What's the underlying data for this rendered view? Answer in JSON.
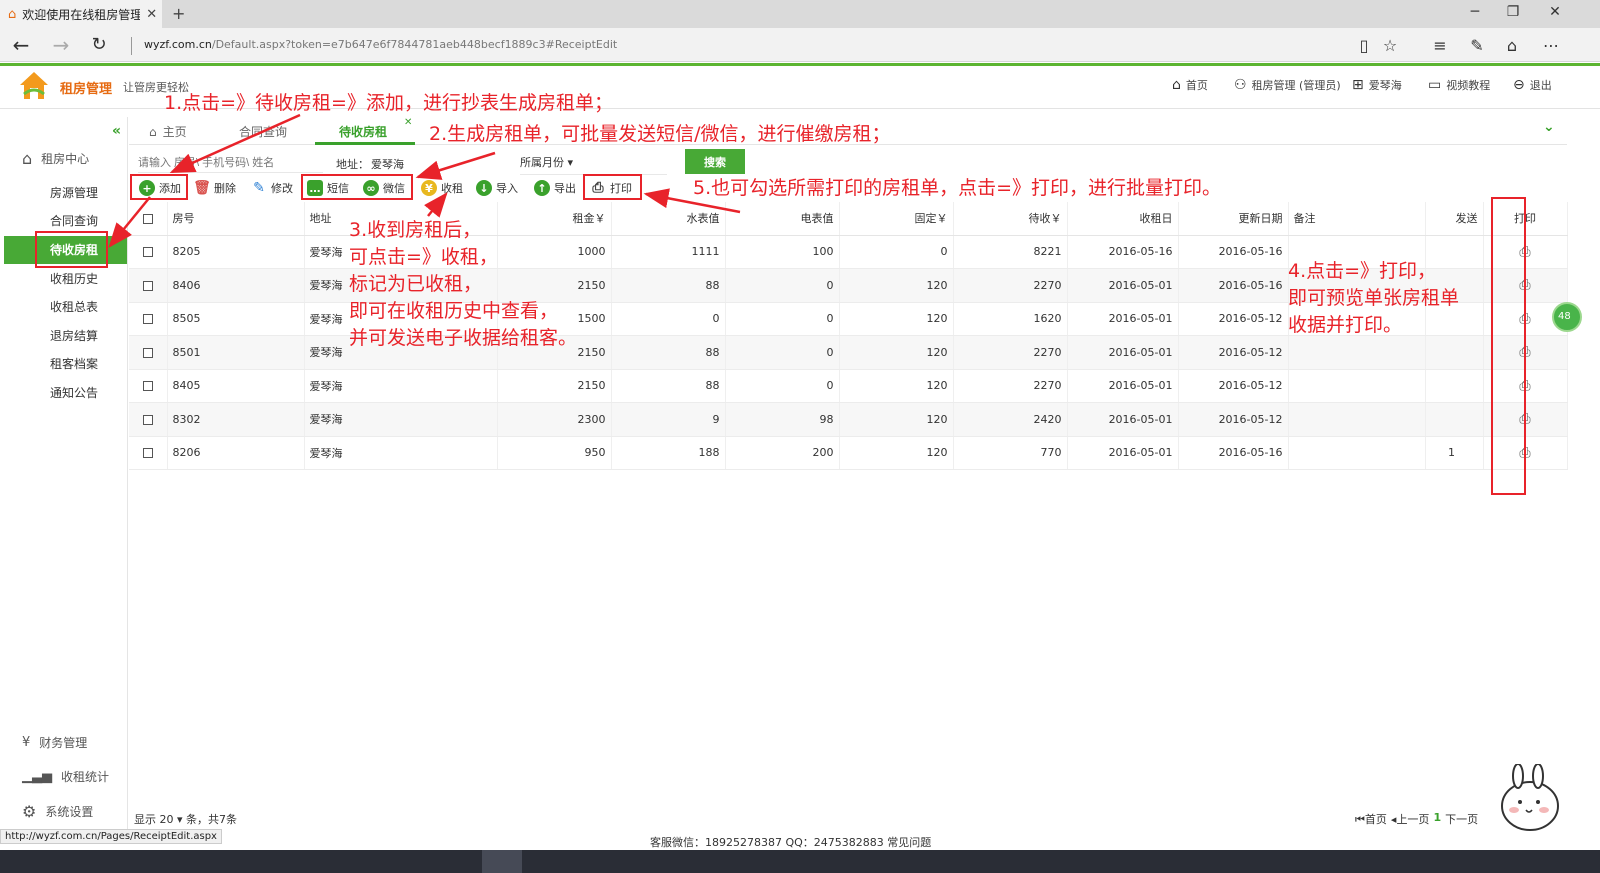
{
  "browser": {
    "tab_title": "欢迎使用在线租房管理",
    "url_domain": "wyzf.com.cn",
    "url_path": "/Default.aspx?token=e7b647e6f7844781aeb448becf1889c3#ReceiptEdit",
    "status_url": "http://wyzf.com.cn/Pages/ReceiptEdit.aspx"
  },
  "header": {
    "app_name": "租房管理",
    "slogan": "让管房更轻松",
    "nav": [
      {
        "label": "首页",
        "icon": "home-icon"
      },
      {
        "label": "租房管理 (管理员)",
        "icon": "user-icon"
      },
      {
        "label": "爱琴海",
        "icon": "sitemap-icon"
      },
      {
        "label": "视频教程",
        "icon": "video-icon"
      },
      {
        "label": "退出",
        "icon": "logout-icon"
      }
    ]
  },
  "sidebar": {
    "main_group": "租房中心",
    "items": [
      "房源管理",
      "合同查询",
      "待收房租",
      "收租历史",
      "收租总表",
      "退房结算",
      "租客档案",
      "通知公告"
    ],
    "active_index": 2,
    "bottom_groups": [
      "财务管理",
      "收租统计",
      "系统设置"
    ]
  },
  "tabs": [
    "主页",
    "合同查询",
    "待收房租"
  ],
  "active_tab": "待收房租",
  "search": {
    "placeholder": "请输入 房号\\ 手机号码\\ 姓名",
    "address_label": "地址：",
    "address_value": "爱琴海",
    "month_label": "所属月份",
    "button": "搜索"
  },
  "toolbar": {
    "add": "添加",
    "delete": "删除",
    "edit": "修改",
    "sms": "短信",
    "wechat": "微信",
    "collect": "收租",
    "import": "导入",
    "export": "导出",
    "print": "打印"
  },
  "table": {
    "headers": [
      "房号",
      "地址",
      "租金￥",
      "水表值",
      "电表值",
      "固定￥",
      "待收￥",
      "收租日",
      "更新日期",
      "备注",
      "发送",
      "打印"
    ],
    "rows": [
      {
        "room": "8205",
        "address": "爱琴海",
        "rent": "1000",
        "water": "1111",
        "electric": "100",
        "fixed": "0",
        "due": "8221",
        "collect_date": "2016-05-16",
        "update_date": "2016-05-16",
        "remark": "",
        "sent": ""
      },
      {
        "room": "8406",
        "address": "爱琴海",
        "rent": "2150",
        "water": "88",
        "electric": "0",
        "fixed": "120",
        "due": "2270",
        "collect_date": "2016-05-01",
        "update_date": "2016-05-16",
        "remark": "",
        "sent": ""
      },
      {
        "room": "8505",
        "address": "爱琴海",
        "rent": "1500",
        "water": "0",
        "electric": "0",
        "fixed": "120",
        "due": "1620",
        "collect_date": "2016-05-01",
        "update_date": "2016-05-12",
        "remark": "",
        "sent": ""
      },
      {
        "room": "8501",
        "address": "爱琴海",
        "rent": "2150",
        "water": "88",
        "electric": "0",
        "fixed": "120",
        "due": "2270",
        "collect_date": "2016-05-01",
        "update_date": "2016-05-12",
        "remark": "",
        "sent": ""
      },
      {
        "room": "8405",
        "address": "爱琴海",
        "rent": "2150",
        "water": "88",
        "electric": "0",
        "fixed": "120",
        "due": "2270",
        "collect_date": "2016-05-01",
        "update_date": "2016-05-12",
        "remark": "",
        "sent": ""
      },
      {
        "room": "8302",
        "address": "爱琴海",
        "rent": "2300",
        "water": "9",
        "electric": "98",
        "fixed": "120",
        "due": "2420",
        "collect_date": "2016-05-01",
        "update_date": "2016-05-12",
        "remark": "",
        "sent": ""
      },
      {
        "room": "8206",
        "address": "爱琴海",
        "rent": "950",
        "water": "188",
        "electric": "200",
        "fixed": "120",
        "due": "770",
        "collect_date": "2016-05-01",
        "update_date": "2016-05-16",
        "remark": "",
        "sent": "1"
      }
    ]
  },
  "pager": {
    "display_prefix": "显示",
    "page_size": "20",
    "display_suffix": "条，共7条",
    "first": "首页",
    "prev": "上一页",
    "current": "1",
    "next": "下一页"
  },
  "contact": "客服微信：18925278387  QQ：2475382883    常见问题",
  "side_badge": "48",
  "annotations": {
    "a1": "1.点击=》待收房租=》添加，进行抄表生成房租单；",
    "a2": "2.生成房租单，可批量发送短信/微信，进行催缴房租；",
    "a3": [
      "3.收到房租后，",
      "可点击=》收租，",
      "标记为已收租，",
      "即可在收租历史中查看，",
      "并可发送电子收据给租客。"
    ],
    "a4": [
      "4.点击=》打印，",
      "即可预览单张房租单",
      "收据并打印。"
    ],
    "a5": "5.也可勾选所需打印的房租单，点击=》打印，进行批量打印。"
  },
  "colors": {
    "accent_green": "#48a936",
    "annotation_red": "#e8232a",
    "brand_orange": "#e66b13"
  }
}
